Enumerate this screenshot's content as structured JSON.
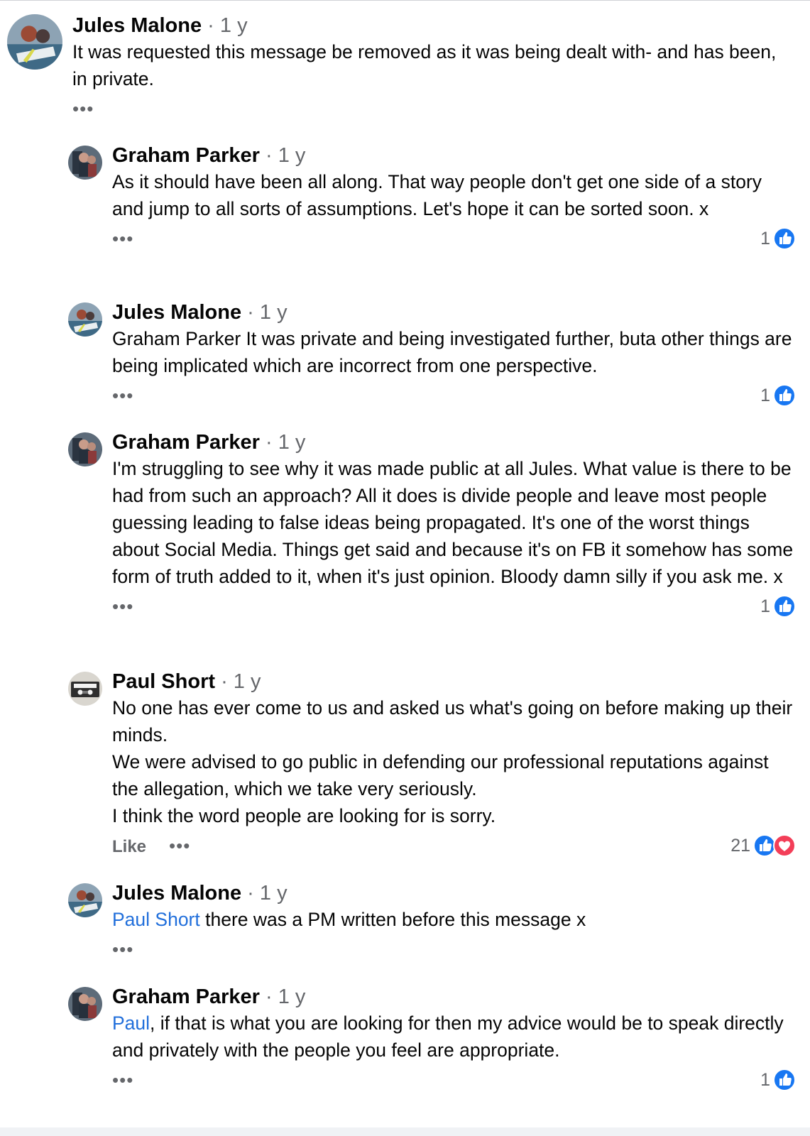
{
  "comments": [
    {
      "author": "Jules Malone",
      "time": "1 y",
      "paragraphs": [
        {
          "link": "",
          "text": "It was requested this message be removed as it was being dealt with- and has been, in private."
        }
      ],
      "like_label": "",
      "reaction_count": ""
    },
    {
      "author": "Graham Parker",
      "time": "1 y",
      "paragraphs": [
        {
          "link": "",
          "text": "As it should have been all along. That way people don't get one side of a story and jump to all sorts of assumptions. Let's hope it can be sorted soon. x"
        }
      ],
      "like_label": "",
      "reaction_count": "1"
    },
    {
      "author": "Jules Malone",
      "time": "1 y",
      "paragraphs": [
        {
          "link": "",
          "text": "Graham Parker It was private and being investigated further, buta other things are being implicated which are incorrect from one perspective."
        }
      ],
      "like_label": "",
      "reaction_count": "1"
    },
    {
      "author": "Graham Parker",
      "time": "1 y",
      "paragraphs": [
        {
          "link": "",
          "text": "I'm struggling to see why it was made public at all Jules. What value is there  to be had from such an approach? All it does is divide people and leave most people guessing leading to false ideas being propagated. It's one of the worst things about Social Media. Things get said and because it's on FB it somehow has some form of truth added to it, when it's just opinion. Bloody damn silly if you ask me. x"
        }
      ],
      "like_label": "",
      "reaction_count": "1"
    },
    {
      "author": "Paul Short",
      "time": "1 y",
      "paragraphs": [
        {
          "link": "",
          "text": "No one has ever come to us and asked us what's going on before making up their minds."
        },
        {
          "link": "",
          "text": "We were advised to go public in defending our professional reputations against the allegation, which we take very seriously."
        },
        {
          "link": "",
          "text": "I think the word people are looking for is sorry."
        }
      ],
      "like_label": "Like",
      "reaction_count": "21"
    },
    {
      "author": "Jules Malone",
      "time": "1 y",
      "paragraphs": [
        {
          "link": "Paul Short",
          "text": " there was a PM written before this message x"
        }
      ],
      "like_label": "",
      "reaction_count": ""
    },
    {
      "author": "Graham Parker",
      "time": "1 y",
      "paragraphs": [
        {
          "link": "Paul",
          "text": ", if that is what you are looking for then my advice would be to speak directly and privately with the people you feel are appropriate."
        }
      ],
      "like_label": "",
      "reaction_count": "1"
    }
  ],
  "separator": " · ",
  "more_glyph": "•••",
  "colors": {
    "like_blue": "#1877f2",
    "love_red": "#f33e58",
    "link_blue": "#216fdb",
    "meta_gray": "#65676b"
  }
}
